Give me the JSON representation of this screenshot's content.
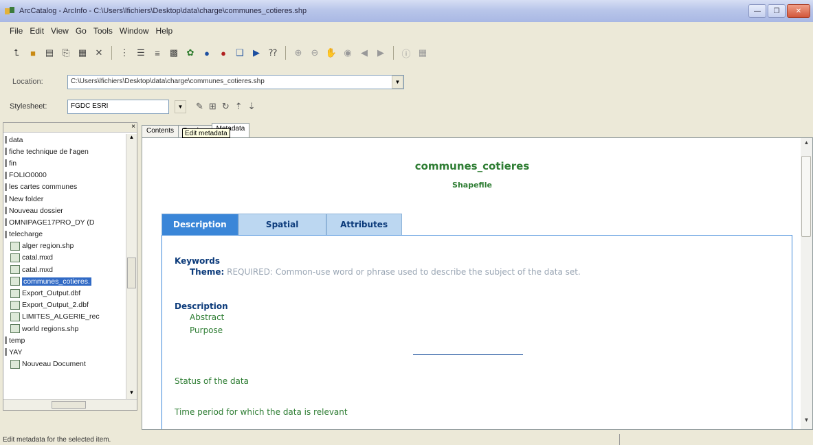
{
  "window": {
    "title": "ArcCatalog - ArcInfo - C:\\Users\\lfichiers\\Desktop\\data\\charge\\communes_cotieres.shp"
  },
  "menu": [
    "File",
    "Edit",
    "View",
    "Go",
    "Tools",
    "Window",
    "Help"
  ],
  "location": {
    "label": "Location:",
    "value": "C:\\Users\\lfichiers\\Desktop\\data\\charge\\communes_cotieres.shp"
  },
  "stylesheet": {
    "label": "Stylesheet:",
    "value": "FGDC ESRI"
  },
  "tree": {
    "items": [
      {
        "label": "data",
        "kind": "folder"
      },
      {
        "label": "fiche technique de l'agen",
        "kind": "folder"
      },
      {
        "label": "fin",
        "kind": "folder"
      },
      {
        "label": "FOLIO0000",
        "kind": "folder"
      },
      {
        "label": "les cartes communes",
        "kind": "folder"
      },
      {
        "label": "New folder",
        "kind": "folder"
      },
      {
        "label": "Nouveau dossier",
        "kind": "folder"
      },
      {
        "label": "OMNIPAGE17PRO_DY (D",
        "kind": "folder"
      },
      {
        "label": "telecharge",
        "kind": "folder"
      },
      {
        "label": "alger region.shp",
        "kind": "child"
      },
      {
        "label": "catal.mxd",
        "kind": "child"
      },
      {
        "label": "catal.mxd",
        "kind": "child"
      },
      {
        "label": "communes_cotieres.",
        "kind": "child",
        "selected": true
      },
      {
        "label": "Export_Output.dbf",
        "kind": "child"
      },
      {
        "label": "Export_Output_2.dbf",
        "kind": "child"
      },
      {
        "label": "LIMITES_ALGERIE_rec",
        "kind": "child"
      },
      {
        "label": "world regions.shp",
        "kind": "child"
      },
      {
        "label": "temp",
        "kind": "folder"
      },
      {
        "label": "YAY",
        "kind": "folder"
      },
      {
        "label": "Nouveau Document",
        "kind": "child"
      }
    ]
  },
  "content_tabs": [
    "Contents",
    "Preview",
    "Metadata"
  ],
  "tooltip": "Edit metadata",
  "metadata": {
    "title": "communes_cotieres",
    "subtitle": "Shapefile",
    "tabs": [
      "Description",
      "Spatial",
      "Attributes"
    ],
    "keywords_heading": "Keywords",
    "theme_label": "Theme:",
    "theme_value": "REQUIRED: Common-use word or phrase used to describe the subject of the data set.",
    "description_heading": "Description",
    "abstract": "Abstract",
    "purpose": "Purpose",
    "status": "Status of the data",
    "time_period": "Time period for which the data is relevant"
  },
  "status_text": "Edit metadata for the selected item."
}
